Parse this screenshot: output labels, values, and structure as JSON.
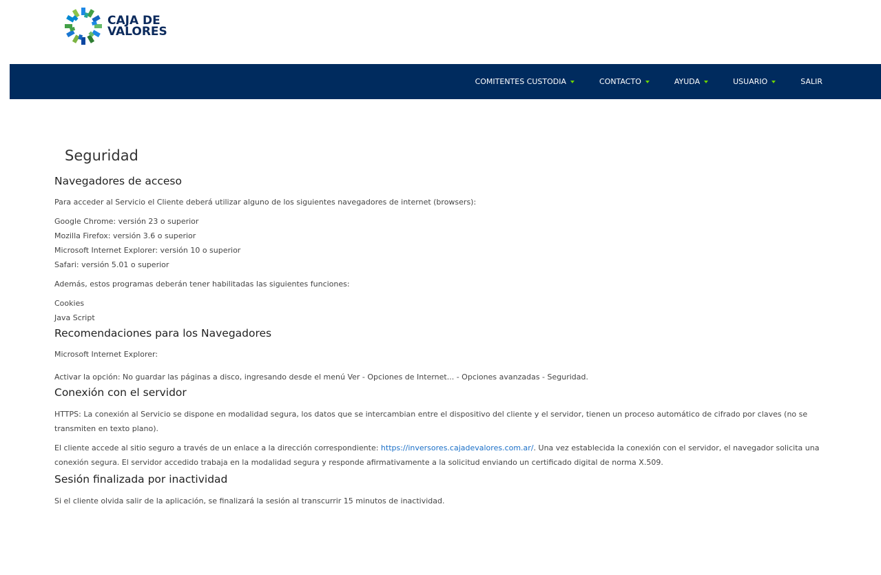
{
  "brand": {
    "logo_line1": "CAJA DE",
    "logo_line2": "VALORES",
    "colors": {
      "navy": "#002b5e",
      "accent_green": "#6dd400",
      "logo_blue": "#0b2a5c",
      "link": "#1a6fc7"
    }
  },
  "nav": {
    "items": [
      {
        "label": "COMITENTES CUSTODIA",
        "dropdown": true
      },
      {
        "label": "CONTACTO",
        "dropdown": true
      },
      {
        "label": "AYUDA",
        "dropdown": true
      },
      {
        "label": "USUARIO",
        "dropdown": true
      },
      {
        "label": "SALIR",
        "dropdown": false
      }
    ]
  },
  "page": {
    "title": "Seguridad",
    "sections": {
      "navegadores": {
        "title": "Navegadores de acceso",
        "intro": "Para acceder al Servicio el Cliente deberá utilizar alguno de los siguientes navegadores de internet (browsers):",
        "browsers": [
          "Google Chrome: versión 23 o superior",
          "Mozilla Firefox: versión 3.6 o superior",
          "Microsoft Internet Explorer: versión 10 o superior",
          "Safari: versión 5.01 o superior"
        ],
        "functions_intro": "Además, estos programas deberán tener habilitadas las siguientes funciones:",
        "functions": [
          "Cookies",
          "Java Script"
        ]
      },
      "recomendaciones": {
        "title": "Recomendaciones para los Navegadores",
        "browser": "Microsoft Internet Explorer:",
        "text": "Activar la opción: No guardar las páginas a disco, ingresando desde el menú Ver - Opciones de Internet... - Opciones avanzadas - Seguridad."
      },
      "conexion": {
        "title": "Conexión con el servidor",
        "https_text": "HTTPS: La conexión al Servicio se dispone en modalidad segura, los datos que se intercambian entre el dispositivo del cliente y el servidor, tienen un proceso automático de cifrado por claves (no se transmiten en texto plano).",
        "link_before": "El cliente accede al sitio seguro a través de un enlace a la dirección correspondiente: ",
        "link_url": "https://inversores.cajadevalores.com.ar/",
        "link_after": ". Una vez establecida la conexión con el servidor, el navegador solicita una conexión segura. El servidor accedido trabaja en la modalidad segura y responde afirmativamente a la solicitud enviando un certificado digital de norma X.509."
      },
      "sesion": {
        "title": "Sesión finalizada por inactividad",
        "text": "Si el cliente olvida salir de la aplicación, se finalizará la sesión al transcurrir 15 minutos de inactividad."
      }
    }
  }
}
